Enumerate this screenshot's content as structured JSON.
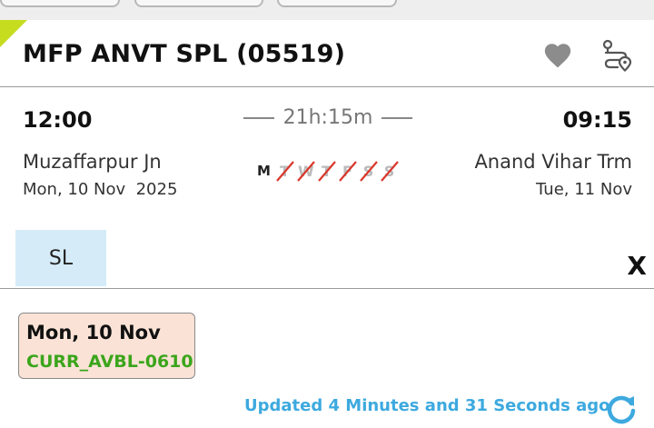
{
  "train": {
    "name": "MFP ANVT SPL (05519)"
  },
  "journey": {
    "departure_time": "12:00",
    "arrival_time": "09:15",
    "duration": "21h:15m",
    "from_station": "Muzaffarpur Jn",
    "to_station": "Anand Vihar Trm",
    "departure_date": "Mon, 10 Nov  2025",
    "arrival_date": "Tue, 11 Nov"
  },
  "running_days": [
    {
      "letter": "M",
      "runs": true
    },
    {
      "letter": "T",
      "runs": false
    },
    {
      "letter": "W",
      "runs": false
    },
    {
      "letter": "T",
      "runs": false
    },
    {
      "letter": "F",
      "runs": false
    },
    {
      "letter": "S",
      "runs": false
    },
    {
      "letter": "S",
      "runs": false
    }
  ],
  "class_tab": {
    "label": "SL",
    "close_label": "X"
  },
  "availability": {
    "date": "Mon, 10 Nov",
    "status": "CURR_AVBL-0610"
  },
  "footer": {
    "updated_text": "Updated 4 Minutes and 31 Seconds ago"
  },
  "colors": {
    "accent_blue": "#3da9df",
    "available_green": "#3ba51c",
    "card_bg": "#fae3d6",
    "class_tab_bg": "#d5ecf8",
    "strike_red": "#d9362b",
    "corner_flag": "#c6dc1f"
  },
  "icons": {
    "favorite": "heart-icon",
    "route": "route-map-icon",
    "refresh": "refresh-icon"
  }
}
